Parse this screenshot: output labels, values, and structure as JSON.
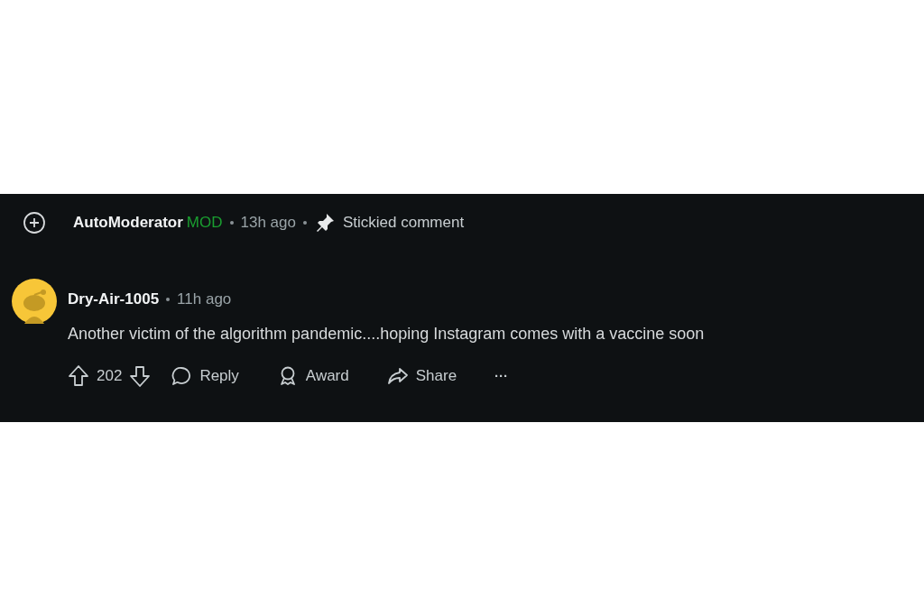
{
  "stickied": {
    "author": "AutoModerator",
    "badge": "MOD",
    "time": "13h ago",
    "note": "Stickied comment"
  },
  "comment": {
    "author": "Dry-Air-1005",
    "time": "11h ago",
    "body": "Another victim of the algorithm pandemic....hoping Instagram comes with a vaccine soon",
    "score": "202",
    "actions": [
      {
        "kind": "reply",
        "label": "Reply"
      },
      {
        "kind": "award",
        "label": "Award"
      },
      {
        "kind": "share",
        "label": "Share"
      },
      {
        "kind": "more",
        "label": "···"
      }
    ]
  }
}
